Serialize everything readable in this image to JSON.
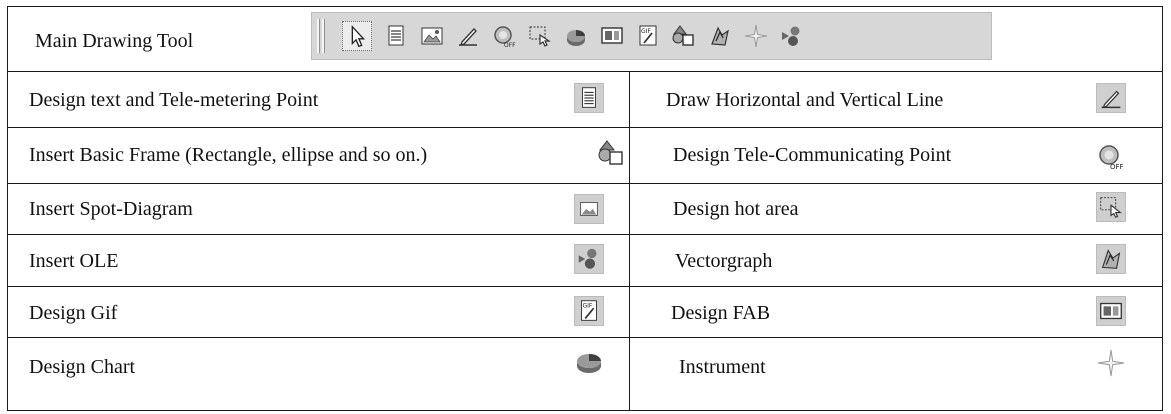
{
  "header": {
    "title": "Main Drawing Tool",
    "toolbar_icons": [
      "pointer-icon",
      "text-icon",
      "picture-icon",
      "pen-icon",
      "switch-off-icon",
      "hotarea-icon",
      "chart-icon",
      "fab-icon",
      "gif-icon",
      "shapes-icon",
      "vectorgraph-icon",
      "instrument-icon",
      "ole-icon"
    ]
  },
  "rows": [
    {
      "left": {
        "label": "Design text and Tele-metering Point",
        "icon": "text-icon"
      },
      "right": {
        "label": "Draw Horizontal and Vertical Line",
        "icon": "pen-icon"
      }
    },
    {
      "left": {
        "label": "Insert Basic Frame (Rectangle, ellipse and so on.)",
        "icon": "shapes-icon"
      },
      "right": {
        "label": "Design Tele-Communicating Point",
        "icon": "switch-off-icon"
      }
    },
    {
      "left": {
        "label": "Insert Spot-Diagram",
        "icon": "picture-icon"
      },
      "right": {
        "label": "Design hot area",
        "icon": "hotarea-icon"
      }
    },
    {
      "left": {
        "label": "Insert OLE",
        "icon": "ole-icon"
      },
      "right": {
        "label": "Vectorgraph",
        "icon": "vectorgraph-icon"
      }
    },
    {
      "left": {
        "label": "Design Gif",
        "icon": "gif-icon"
      },
      "right": {
        "label": "Design FAB",
        "icon": "fab-icon"
      }
    },
    {
      "left": {
        "label": "Design Chart",
        "icon": "chart-icon"
      },
      "right": {
        "label": "Instrument",
        "icon": "instrument-icon"
      }
    }
  ]
}
